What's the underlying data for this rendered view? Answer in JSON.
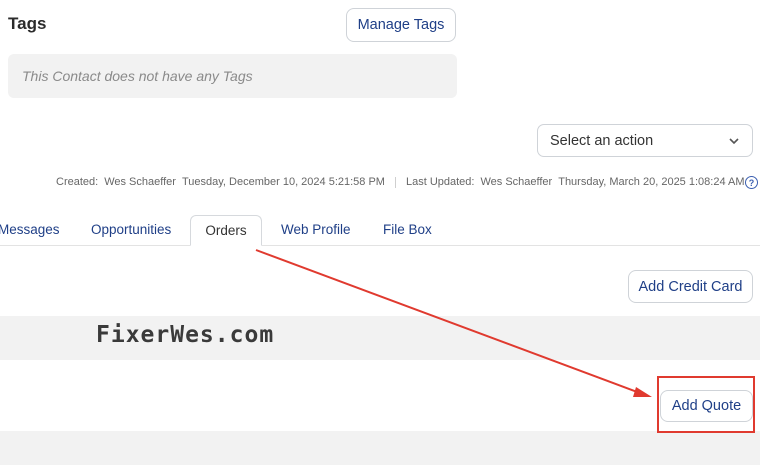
{
  "tags": {
    "heading": "Tags",
    "manage_button": "Manage Tags",
    "empty_message": "This Contact does not have any Tags"
  },
  "actions": {
    "select_placeholder": "Select an action"
  },
  "meta": {
    "created_label": "Created:",
    "created_by": "Wes Schaeffer",
    "created_at": "Tuesday, December 10, 2024 5:21:58 PM",
    "updated_label": "Last Updated:",
    "updated_by": "Wes Schaeffer",
    "updated_at": "Thursday, March 20, 2025 1:08:24 AM"
  },
  "tabs": [
    {
      "label": "Messages"
    },
    {
      "label": "Opportunities"
    },
    {
      "label": "Orders",
      "active": true
    },
    {
      "label": "Web Profile"
    },
    {
      "label": "File Box"
    }
  ],
  "orders": {
    "add_credit_card": "Add Credit Card",
    "add_quote": "Add Quote"
  },
  "watermark": "FixerWes.com",
  "colors": {
    "link": "#1f3f87",
    "annotation": "#e03a2f",
    "band": "#f2f2f2"
  }
}
